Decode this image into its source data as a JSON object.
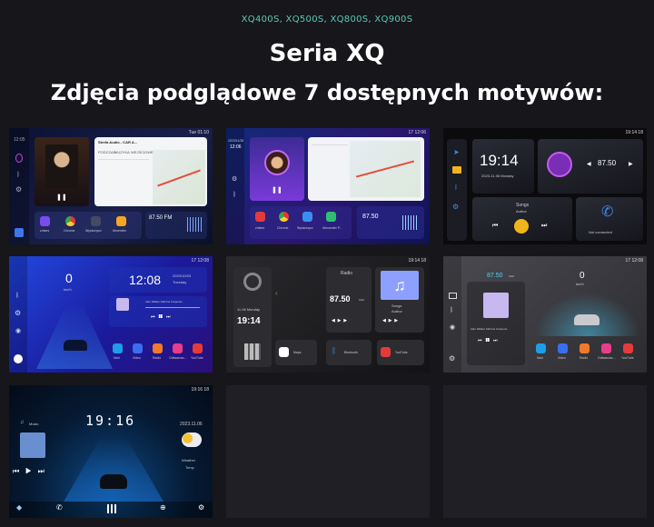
{
  "header": {
    "models": "XQ400S, XQ500S, XQ800S, XQ900S",
    "title": "Seria XQ",
    "subtitle": "Zdjęcia podglądowe 7 dostępnych motywów:"
  },
  "themes": [
    {
      "id": 1,
      "time": "12:05",
      "status": "Tue 01:10",
      "nav_title": "Strefa Audio - CAR A...",
      "music_labels": [
        "PODCZAS",
        "MUZYKA",
        "WEJŚCIOWE"
      ],
      "radio_freq": "87.50 FM",
      "apps": [
        "zmkes",
        "Chrome",
        "Wyskonyuv",
        "Morerdier"
      ],
      "colors": {
        "bg": "#0d1330",
        "accent": "#3c5bd6"
      }
    },
    {
      "id": 2,
      "date": "2023/11/28",
      "time": "12:06",
      "status": "17  12:06",
      "radio_freq": "87.50",
      "apps": [
        "zmkes",
        "Chrome",
        "Wyskonyuv",
        "Alexander P..."
      ],
      "colors": {
        "bg": "#142056",
        "accent": "#7b4dff"
      }
    },
    {
      "id": 3,
      "time": "19:14",
      "date": "2023-11-06 Monday",
      "status": "19:14  18",
      "radio_freq": "87.50",
      "song": "Songs",
      "author": "Author",
      "phone_status": "Not connected",
      "colors": {
        "bg": "#0c0c10",
        "accent": "#f0b51c"
      }
    },
    {
      "id": 4,
      "speed": "0",
      "speed_unit": "km/h",
      "time": "12:08",
      "date": "2023/10/03",
      "day": "Tuesday",
      "status": "17  12:08",
      "artist": "Alan Walker,Sabrina Carpente...",
      "apps": [
        "Navi",
        "Video",
        "Radio",
        "Odtwarzac...",
        "YouTube"
      ],
      "colors": {
        "bg": "#1a2aa6",
        "accent": "#35c7ff"
      }
    },
    {
      "id": 5,
      "date": "11.06 Monday",
      "time": "19:14",
      "status": "19:14  18",
      "radio_title": "Radio",
      "radio_freq": "87.50",
      "radio_unit": "KHZ",
      "song": "Songs",
      "author": "Author",
      "apps": [
        "Maps",
        "Bluetooth",
        "YouTube"
      ],
      "colors": {
        "bg": "#1a1a1c",
        "accent": "#8ea0ff"
      }
    },
    {
      "id": 6,
      "radio_freq": "87.50",
      "radio_unit": "KHZ",
      "speed": "0",
      "speed_unit": "km/h",
      "status": "17  12:08",
      "artist": "Alan Walker,Sabrina Carpente...",
      "apps": [
        "Navi",
        "Video",
        "Radio",
        "Odtwarzac...",
        "YouTube"
      ],
      "colors": {
        "bg": "#3a3a3e",
        "accent": "#4dd2ff"
      }
    },
    {
      "id": 7,
      "time": "19:16",
      "status": "19:16  18",
      "music_label": "Music",
      "date": "2023.11.06",
      "weather_label": "Weather",
      "weather_sub": "Temp",
      "colors": {
        "bg": "#07223f",
        "accent": "#2d8cff"
      }
    }
  ]
}
